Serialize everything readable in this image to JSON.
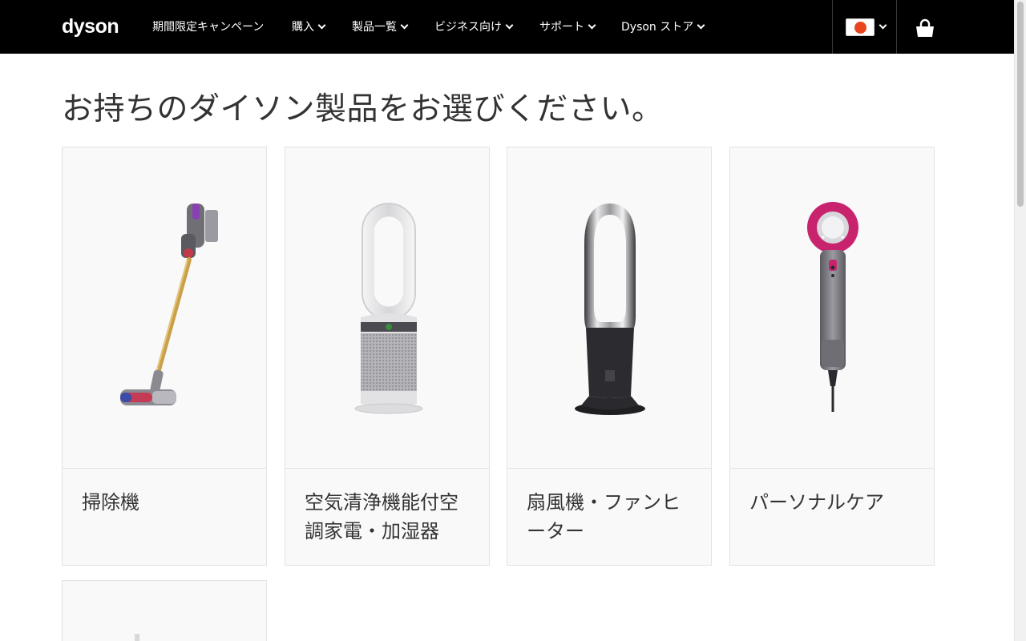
{
  "header": {
    "logo": "dyson",
    "nav": [
      {
        "label": "期間限定キャンペーン",
        "has_dropdown": false
      },
      {
        "label": "購入",
        "has_dropdown": true
      },
      {
        "label": "製品一覧",
        "has_dropdown": true
      },
      {
        "label": "ビジネス向け",
        "has_dropdown": true
      },
      {
        "label": "サポート",
        "has_dropdown": true
      },
      {
        "label": "Dyson ストア",
        "has_dropdown": true
      }
    ],
    "country_icon": "japan-flag-icon",
    "cart_icon": "shopping-basket-icon"
  },
  "main": {
    "title": "お持ちのダイソン製品をお選びください。",
    "categories": [
      {
        "label": "掃除機",
        "icon": "stick-vacuum-image"
      },
      {
        "label": "空気清浄機能付空調家電・加湿器",
        "icon": "air-purifier-image"
      },
      {
        "label": "扇風機・ファンヒーター",
        "icon": "fan-heater-image"
      },
      {
        "label": "パーソナルケア",
        "icon": "hair-dryer-image"
      }
    ]
  },
  "colors": {
    "header_bg": "#000000",
    "card_bg": "#f9f9f9",
    "dryer_accent": "#c8246e",
    "vacuum_accent": "#c9a04a"
  }
}
